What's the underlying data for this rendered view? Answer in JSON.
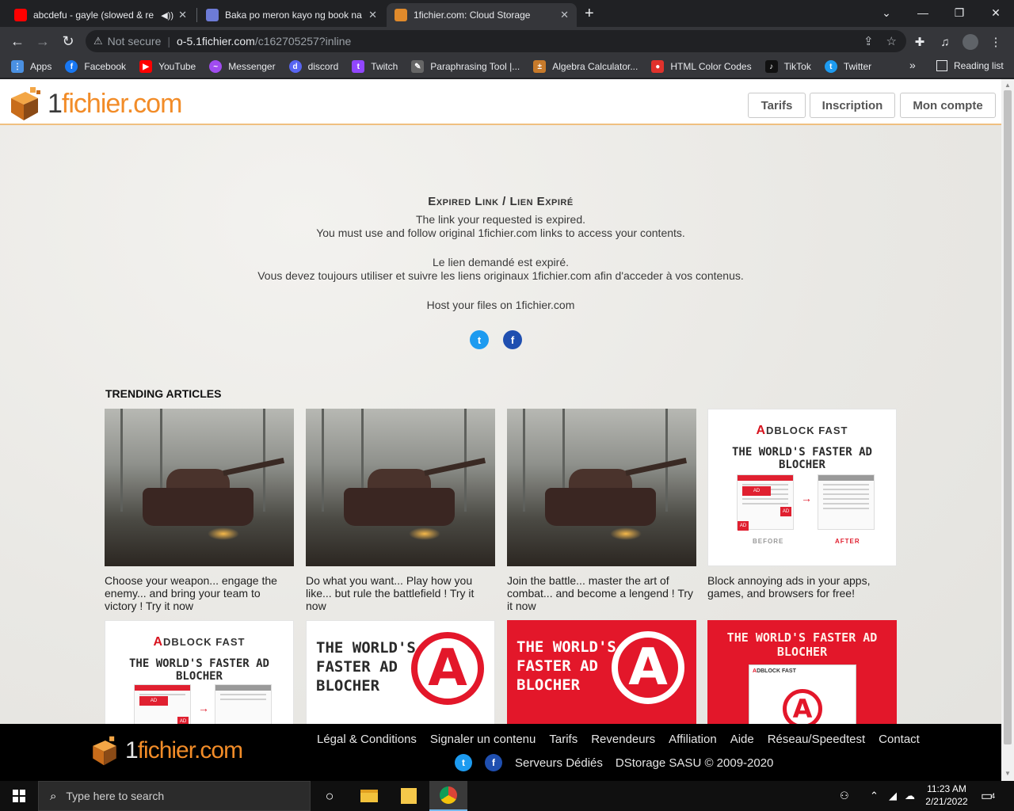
{
  "browser": {
    "tabs": [
      {
        "title": "abcdefu - gayle (slowed & re",
        "favicon": "youtube-icon",
        "color": "#ff0000"
      },
      {
        "title": "Baka po meron kayo ng book na",
        "favicon": "cube-icon",
        "color": "#6d7bd6"
      },
      {
        "title": "1fichier.com: Cloud Storage",
        "favicon": "fichier-icon",
        "color": "#e08a2b"
      }
    ],
    "address": {
      "security": "Not secure",
      "host": "o-5.1fichier.com",
      "path": "/c162705257?inline"
    },
    "bookmarks": [
      {
        "label": "Apps",
        "icon": "apps-grid-icon",
        "color": "#4a90e2"
      },
      {
        "label": "Facebook",
        "icon": "facebook-icon",
        "color": "#1877f2"
      },
      {
        "label": "YouTube",
        "icon": "youtube-icon",
        "color": "#ff0000"
      },
      {
        "label": "Messenger",
        "icon": "messenger-icon",
        "color": "#a04cf0"
      },
      {
        "label": "discord",
        "icon": "discord-icon",
        "color": "#5865f2"
      },
      {
        "label": "Twitch",
        "icon": "twitch-icon",
        "color": "#9146ff"
      },
      {
        "label": "Paraphrasing Tool |...",
        "icon": "pen-icon",
        "color": "#666666"
      },
      {
        "label": "Algebra Calculator...",
        "icon": "calculator-icon",
        "color": "#c77a2a"
      },
      {
        "label": "HTML Color Codes",
        "icon": "colorcodes-icon",
        "color": "#e0322c"
      },
      {
        "label": "TikTok",
        "icon": "tiktok-icon",
        "color": "#111111"
      },
      {
        "label": "Twitter",
        "icon": "twitter-icon",
        "color": "#1d9bf0"
      }
    ],
    "more": "»",
    "reading_list": "Reading list"
  },
  "site": {
    "logo": {
      "one": "1",
      "rest": "fichier.com"
    },
    "nav": {
      "tarifs": "Tarifs",
      "inscription": "Inscription",
      "account": "Mon compte"
    },
    "message": {
      "title": "Expired Link / Lien Expiré",
      "en1": "The link your requested is expired.",
      "en2": "You must use and follow original 1fichier.com links to access your contents.",
      "fr1": "Le lien demandé est expiré.",
      "fr2": "Vous devez toujours utiliser et suivre les liens originaux 1fichier.com afin d'acceder à vos contenus.",
      "host": "Host your files on 1fichier.com"
    },
    "trending_title": "TRENDING ARTICLES",
    "articles": [
      {
        "caption": "Choose your weapon... engage the enemy... and bring your team to victory ! Try it now"
      },
      {
        "caption": "Do what you want... Play how you like... but rule the battlefield ! Try it now"
      },
      {
        "caption": "Join the battle... master the art of combat... and become a lengend ! Try it now"
      },
      {
        "caption": "Block annoying ads in your apps, games, and browsers for free!"
      }
    ],
    "ads": {
      "brand_a": "A",
      "brand_rest": "DBLOCK FAST",
      "slogan": "THE WORLD'S FASTER AD BLOCHER",
      "slogan_l1": "THE WORLD'S",
      "slogan_l2": "FASTER AD",
      "slogan_l3": "BLOCHER",
      "red_l1": "THE WORLD'S FASTER AD",
      "red_l2": "BLOCHER",
      "ad": "AD",
      "before": "BEFORE",
      "after": "AFTER"
    },
    "footer": {
      "links": [
        "Légal & Conditions",
        "Signaler un contenu",
        "Tarifs",
        "Revendeurs",
        "Affiliation",
        "Aide",
        "Réseau/Speedtest",
        "Contact"
      ],
      "dedicated": "Serveurs Dédiés",
      "copyright": "DStorage SASU © 2009-2020"
    }
  },
  "taskbar": {
    "search_placeholder": "Type here to search",
    "time": "11:23 AM",
    "date": "2/21/2022",
    "notifications": "4"
  }
}
